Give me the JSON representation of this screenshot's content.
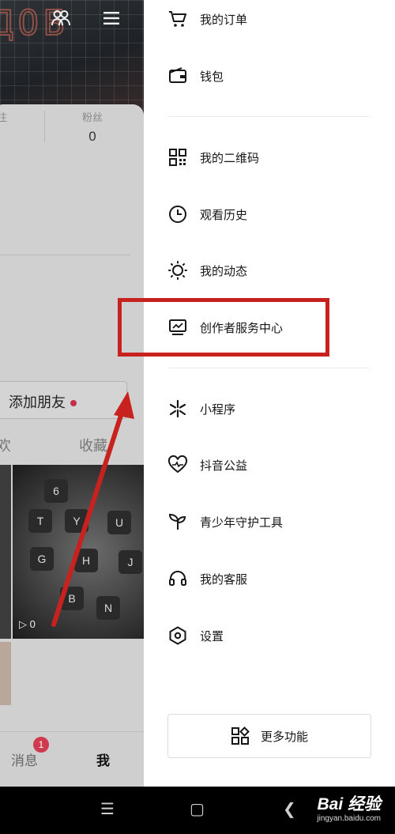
{
  "profile": {
    "stat_left_label": "注",
    "fans_label": "粉丝",
    "fans_count": "0",
    "add_friend_label": "添加朋友",
    "tab_likes": "欢",
    "tab_favorites": "收藏",
    "video_play_count": "0",
    "keys": [
      "6",
      "T",
      "Y",
      "U",
      "G",
      "H",
      "J",
      "B",
      "N"
    ]
  },
  "bottom_nav": {
    "messages_label": "消息",
    "messages_badge": "1",
    "me_label": "我"
  },
  "drawer": {
    "items": [
      {
        "label": "我的订单",
        "icon": "cart-icon"
      },
      {
        "label": "钱包",
        "icon": "wallet-icon"
      },
      {
        "label": "我的二维码",
        "icon": "qrcode-icon"
      },
      {
        "label": "观看历史",
        "icon": "clock-icon"
      },
      {
        "label": "我的动态",
        "icon": "sun-icon"
      },
      {
        "label": "创作者服务中心",
        "icon": "creator-monitor-icon"
      },
      {
        "label": "小程序",
        "icon": "asterisk-icon"
      },
      {
        "label": "抖音公益",
        "icon": "heart-charity-icon"
      },
      {
        "label": "青少年守护工具",
        "icon": "sprout-icon"
      },
      {
        "label": "我的客服",
        "icon": "headset-icon"
      },
      {
        "label": "设置",
        "icon": "hexagon-settings-icon"
      }
    ],
    "more_label": "更多功能"
  },
  "watermark": {
    "brand": "Bai  经验",
    "url": "jingyan.baidu.com"
  },
  "colors": {
    "highlight": "#c8221f",
    "badge": "#d03a4e"
  }
}
